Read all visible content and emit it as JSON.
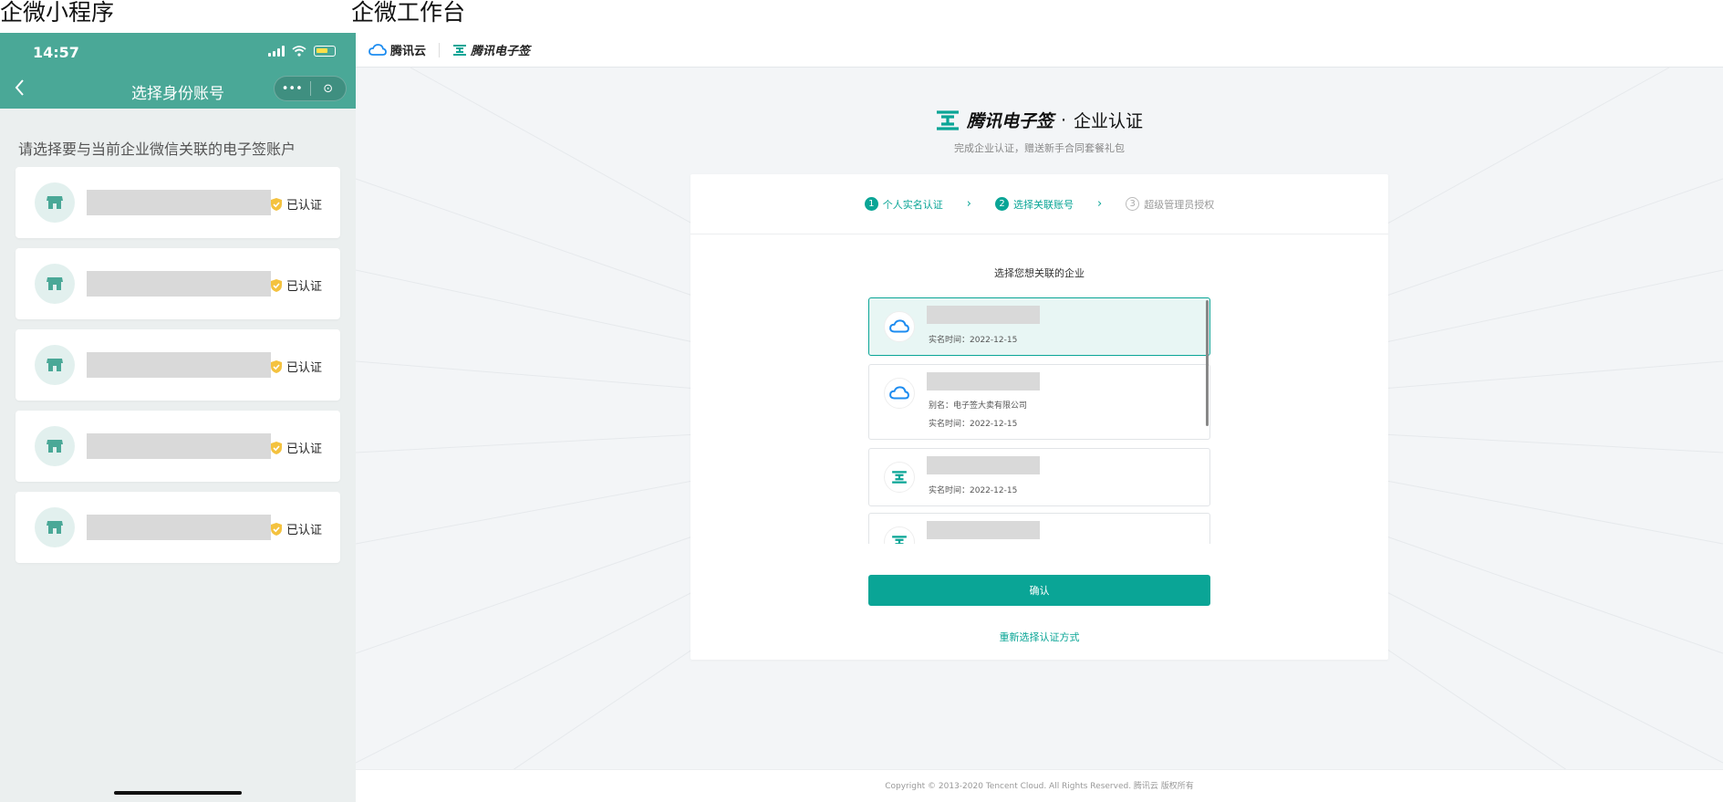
{
  "labels": {
    "left": "企微小程序",
    "right": "企微工作台"
  },
  "phone": {
    "time": "14:57",
    "nav_title": "选择身份账号",
    "back_icon": "chevron-left-icon",
    "capsule": {
      "more": "•••",
      "close": "⊙"
    },
    "prompt": "请选择要与当前企业微信关联的电子签账户",
    "accounts": [
      {
        "badge": "已认证"
      },
      {
        "badge": "已认证"
      },
      {
        "badge": "已认证"
      },
      {
        "badge": "已认证"
      },
      {
        "badge": "已认证"
      }
    ],
    "colors": {
      "header": "#4aa897",
      "badge": "#f4c23f"
    }
  },
  "desktop": {
    "topbar": {
      "cloud": "腾讯云",
      "ess": "腾讯电子签"
    },
    "brand": {
      "name": "腾讯电子签",
      "dot": "·",
      "title": "企业认证",
      "desc": "完成企业认证，赠送新手合同套餐礼包"
    },
    "steps": [
      {
        "num": "1",
        "label": "个人实名认证",
        "state": "done"
      },
      {
        "num": "2",
        "label": "选择关联账号",
        "state": "active"
      },
      {
        "num": "3",
        "label": "超级管理员授权",
        "state": "todo"
      }
    ],
    "select_title": "选择您想关联的企业",
    "enterprises": [
      {
        "icon": "tencent-cloud-icon",
        "alias": "",
        "realname_time": "实名时间：2022-12-15"
      },
      {
        "icon": "tencent-cloud-icon",
        "alias": "别名：电子签大卖有限公司",
        "realname_time": "实名时间：2022-12-15"
      },
      {
        "icon": "ess-icon",
        "alias": "",
        "realname_time": "实名时间：2022-12-15"
      },
      {
        "icon": "ess-icon",
        "alias": "",
        "realname_time": ""
      }
    ],
    "confirm_label": "确认",
    "reselect_label": "重新选择认证方式",
    "footer": "Copyright © 2013-2020 Tencent Cloud. All Rights Reserved. 腾讯云 版权所有",
    "colors": {
      "primary": "#0aa596"
    }
  }
}
